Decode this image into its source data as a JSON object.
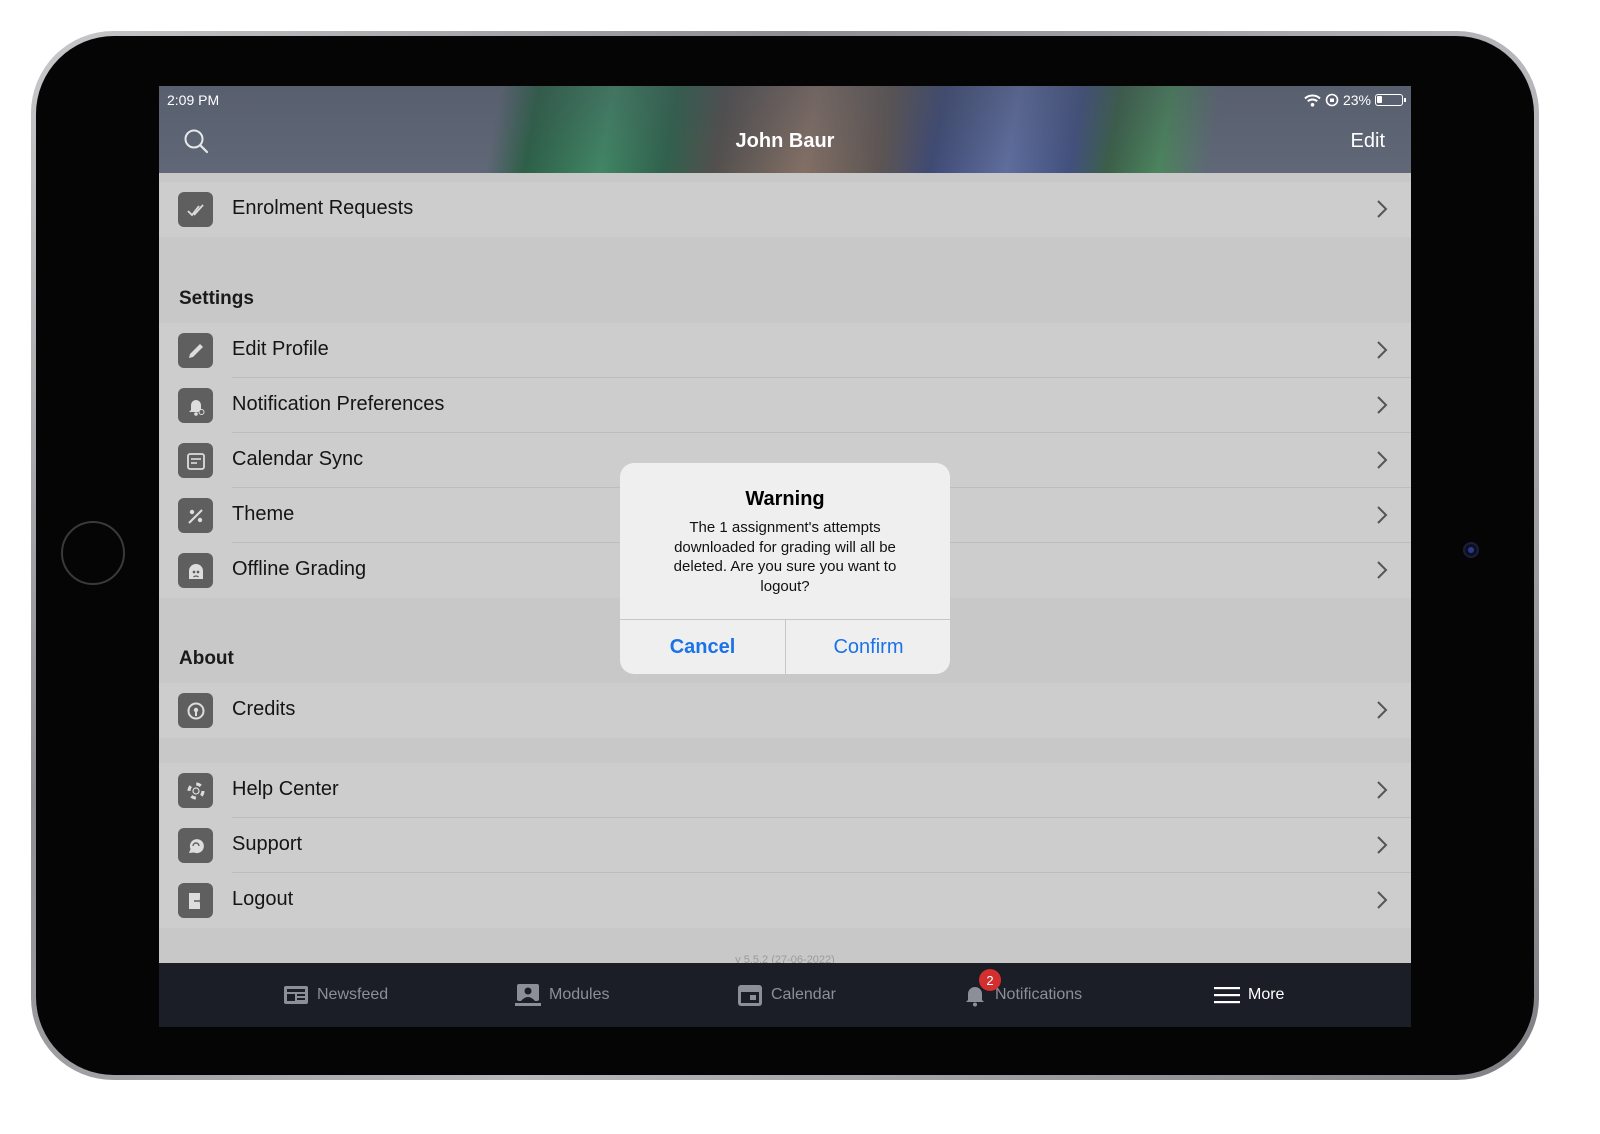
{
  "status_bar": {
    "time": "2:09 PM",
    "battery": "23%"
  },
  "header": {
    "title": "John Baur",
    "edit_label": "Edit",
    "search_icon": "search-icon"
  },
  "rows": {
    "enrolment": "Enrolment Requests",
    "edit_profile": "Edit Profile",
    "notification_preferences": "Notification Preferences",
    "calendar_sync": "Calendar Sync",
    "theme": "Theme",
    "offline_grading": "Offline Grading",
    "credits": "Credits",
    "help_center": "Help Center",
    "support": "Support",
    "logout": "Logout"
  },
  "sections": {
    "settings": "Settings",
    "about": "About"
  },
  "version": "v 5.5.2 (27-06-2022)",
  "tabbar": {
    "newsfeed": "Newsfeed",
    "modules": "Modules",
    "calendar": "Calendar",
    "notifications": "Notifications",
    "notifications_badge": "2",
    "more": "More"
  },
  "dialog": {
    "title": "Warning",
    "message": "The 1 assignment's attempts downloaded for grading will all be deleted. Are you sure you want to logout?",
    "cancel_label": "Cancel",
    "confirm_label": "Confirm"
  },
  "colors": {
    "accent": "#1a73e8",
    "badge": "#d32f2f",
    "tabbar_bg": "#1b1e27"
  }
}
